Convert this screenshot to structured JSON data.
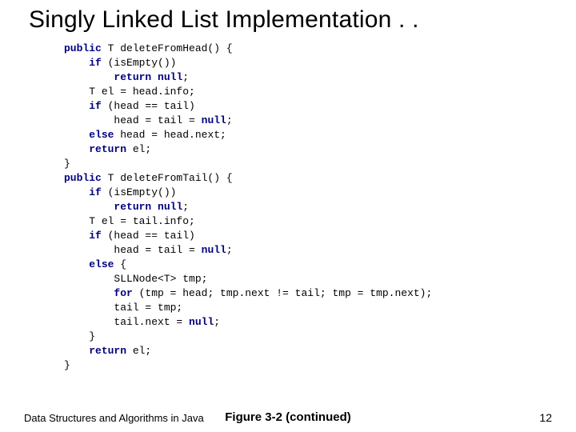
{
  "title": "Singly Linked List Implementation . .",
  "code": {
    "lines": [
      {
        "indent": 0,
        "segs": [
          {
            "t": "public",
            "c": "kw"
          },
          {
            "t": " T deleteFromHead() {"
          }
        ]
      },
      {
        "indent": 1,
        "segs": [
          {
            "t": "if",
            "c": "kw"
          },
          {
            "t": " (isEmpty())"
          }
        ]
      },
      {
        "indent": 2,
        "segs": [
          {
            "t": "return",
            "c": "kw"
          },
          {
            "t": " "
          },
          {
            "t": "null",
            "c": "kw"
          },
          {
            "t": ";"
          }
        ]
      },
      {
        "indent": 1,
        "segs": [
          {
            "t": "T el = head.info;"
          }
        ]
      },
      {
        "indent": 1,
        "segs": [
          {
            "t": "if",
            "c": "kw"
          },
          {
            "t": " (head == tail)"
          }
        ]
      },
      {
        "indent": 2,
        "segs": [
          {
            "t": "head = tail = "
          },
          {
            "t": "null",
            "c": "kw"
          },
          {
            "t": ";"
          }
        ]
      },
      {
        "indent": 1,
        "segs": [
          {
            "t": "else",
            "c": "kw"
          },
          {
            "t": " head = head.next;"
          }
        ]
      },
      {
        "indent": 1,
        "segs": [
          {
            "t": "return",
            "c": "kw"
          },
          {
            "t": " el;"
          }
        ]
      },
      {
        "indent": 0,
        "segs": [
          {
            "t": "}"
          }
        ]
      },
      {
        "indent": 0,
        "segs": [
          {
            "t": "public",
            "c": "kw"
          },
          {
            "t": " T deleteFromTail() {"
          }
        ]
      },
      {
        "indent": 1,
        "segs": [
          {
            "t": "if",
            "c": "kw"
          },
          {
            "t": " (isEmpty())"
          }
        ]
      },
      {
        "indent": 2,
        "segs": [
          {
            "t": "return",
            "c": "kw"
          },
          {
            "t": " "
          },
          {
            "t": "null",
            "c": "kw"
          },
          {
            "t": ";"
          }
        ]
      },
      {
        "indent": 1,
        "segs": [
          {
            "t": "T el = tail.info;"
          }
        ]
      },
      {
        "indent": 1,
        "segs": [
          {
            "t": "if",
            "c": "kw"
          },
          {
            "t": " (head == tail)"
          }
        ]
      },
      {
        "indent": 2,
        "segs": [
          {
            "t": "head = tail = "
          },
          {
            "t": "null",
            "c": "kw"
          },
          {
            "t": ";"
          }
        ]
      },
      {
        "indent": 1,
        "segs": [
          {
            "t": "else",
            "c": "kw"
          },
          {
            "t": " {"
          }
        ]
      },
      {
        "indent": 2,
        "segs": [
          {
            "t": "SLLNode<T> tmp;"
          }
        ]
      },
      {
        "indent": 2,
        "segs": [
          {
            "t": "for",
            "c": "kw"
          },
          {
            "t": " (tmp = head; tmp.next != tail; tmp = tmp.next);"
          }
        ]
      },
      {
        "indent": 2,
        "segs": [
          {
            "t": "tail = tmp;"
          }
        ]
      },
      {
        "indent": 2,
        "segs": [
          {
            "t": "tail.next = "
          },
          {
            "t": "null",
            "c": "kw"
          },
          {
            "t": ";"
          }
        ]
      },
      {
        "indent": 1,
        "segs": [
          {
            "t": "}"
          }
        ]
      },
      {
        "indent": 1,
        "segs": [
          {
            "t": "return",
            "c": "kw"
          },
          {
            "t": " el;"
          }
        ]
      },
      {
        "indent": 0,
        "segs": [
          {
            "t": "}"
          }
        ]
      }
    ],
    "indentUnit": "    "
  },
  "footer": {
    "left": "Data Structures and Algorithms in Java",
    "center": "Figure 3-2   (continued)",
    "right": "12"
  }
}
